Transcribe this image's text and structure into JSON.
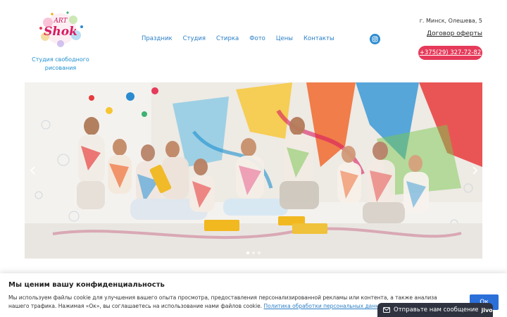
{
  "logo": {
    "name": "ART Shok",
    "icon": "paint-splash-logo"
  },
  "header": {
    "tagline": "Студия свободного рисования",
    "address": "г. Минск, Олешева, 5",
    "offer_link": "Договор оферты",
    "phone": "+375(29) 327-72-82"
  },
  "nav": {
    "items": [
      "Праздник",
      "Студия",
      "Стирка",
      "Фото",
      "Цены",
      "Контакты"
    ],
    "social_icon": "instagram-icon"
  },
  "slider": {
    "prev_icon": "chevron-left-icon",
    "next_icon": "chevron-right-icon",
    "slide_count": 3,
    "active_slide": 1
  },
  "cookie": {
    "title": "Мы ценим вашу конфиденциальность",
    "text": "Мы используем файлы cookie для улучшения вашего опыта просмотра, предоставления персонализированной рекламы или контента, а также анализа нашего трафика. Нажимая «Ок», вы соглашаетесь на использование нами файлов cookie.",
    "link": "Политика обработки персональных данных",
    "ok": "Ок"
  },
  "chat": {
    "label": "Отправьте нам сообщение",
    "brand": "jivo",
    "icon": "envelope-icon"
  },
  "colors": {
    "nav_text": "#2b7fc6",
    "phone_button": "#e63a5a",
    "ok_button": "#2b6fd8",
    "chat_bg": "#2f3340"
  }
}
